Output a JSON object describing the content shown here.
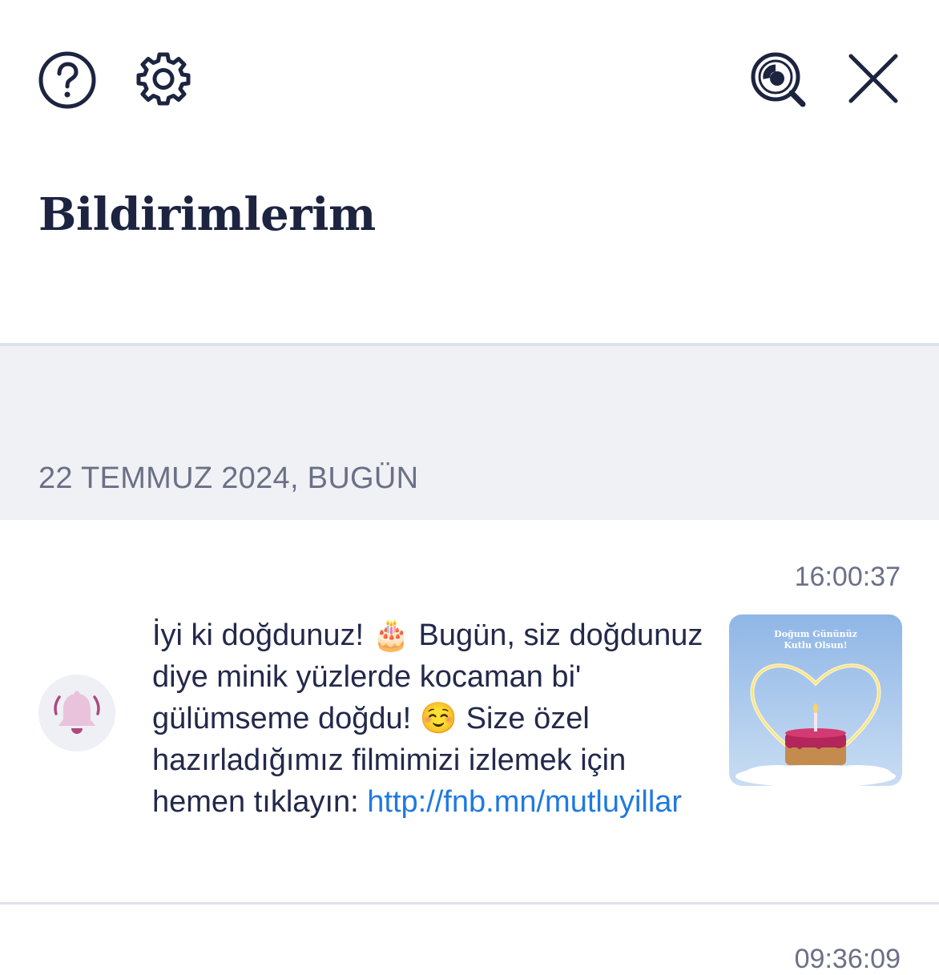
{
  "header": {
    "help_icon": "help-circle-icon",
    "settings_icon": "gear-icon",
    "search_icon": "search-icon",
    "close_icon": "close-icon",
    "title": "Bildirimlerim"
  },
  "date_group": {
    "label": "22 TEMMUZ 2024, BUGÜN"
  },
  "notifications": [
    {
      "time": "16:00:37",
      "icon": "bell-ringing-icon",
      "text_before_link": "İyi ki doğdunuz! 🎂 Bugün, siz doğdunuz diye minik yüzlerde kocaman bi' gülümseme doğdu! ☺️ Size özel hazırladığımız filmimizi izlemek için hemen tıklayın: ",
      "link": "http://fnb.mn/mutluyillar",
      "thumbnail": {
        "caption_line1": "Doğum Gününüz",
        "caption_line2": "Kutlu Olsun!"
      }
    },
    {
      "time": "09:36:09"
    }
  ],
  "colors": {
    "primary_text": "#1d2440",
    "muted_text": "#6b7086",
    "link": "#1f7ae0",
    "section_bg": "#eff1f5",
    "bell": "#b0487e"
  }
}
